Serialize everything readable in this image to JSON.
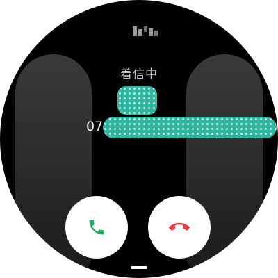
{
  "call": {
    "status_text": "着信中",
    "caller_name": "",
    "caller_number_prefix": "07"
  },
  "buttons": {
    "accept": {
      "icon": "phone-accept-icon",
      "color": "#1daf5b"
    },
    "decline": {
      "icon": "phone-decline-icon",
      "color": "#ee3b43"
    }
  },
  "colors": {
    "background": "#000000",
    "status_text": "#bdbdbd",
    "redaction": "#2db6a0"
  }
}
